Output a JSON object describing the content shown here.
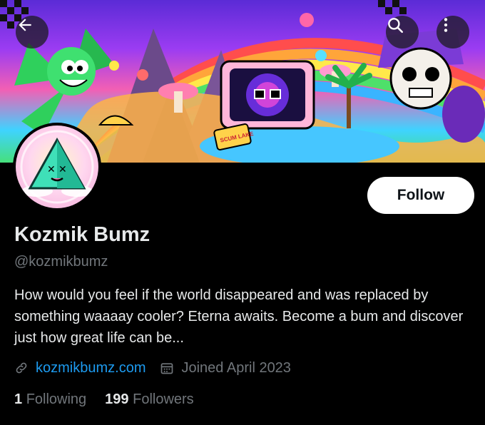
{
  "profile": {
    "name": "Kozmik Bumz",
    "handle": "@kozmikbumz",
    "bio": "How would you feel if the world disappeared and was replaced by something waaaay cooler? Eterna awaits. Become a bum and discover just how great life can be...",
    "website": "kozmikbumz.com",
    "joined": "Joined April 2023"
  },
  "actions": {
    "follow_label": "Follow"
  },
  "banner": {
    "sign_text": "SCUM LAKE"
  },
  "stats": {
    "following_count": "1",
    "following_label": "Following",
    "followers_count": "199",
    "followers_label": "Followers"
  },
  "icons": {
    "back": "arrow-left-icon",
    "search": "search-icon",
    "more": "more-vertical-icon",
    "link": "link-icon",
    "calendar": "calendar-icon"
  },
  "colors": {
    "background": "#000000",
    "text": "#e7e9ea",
    "muted": "#71767b",
    "link": "#1d9bf0",
    "follow_bg": "#ffffff"
  }
}
